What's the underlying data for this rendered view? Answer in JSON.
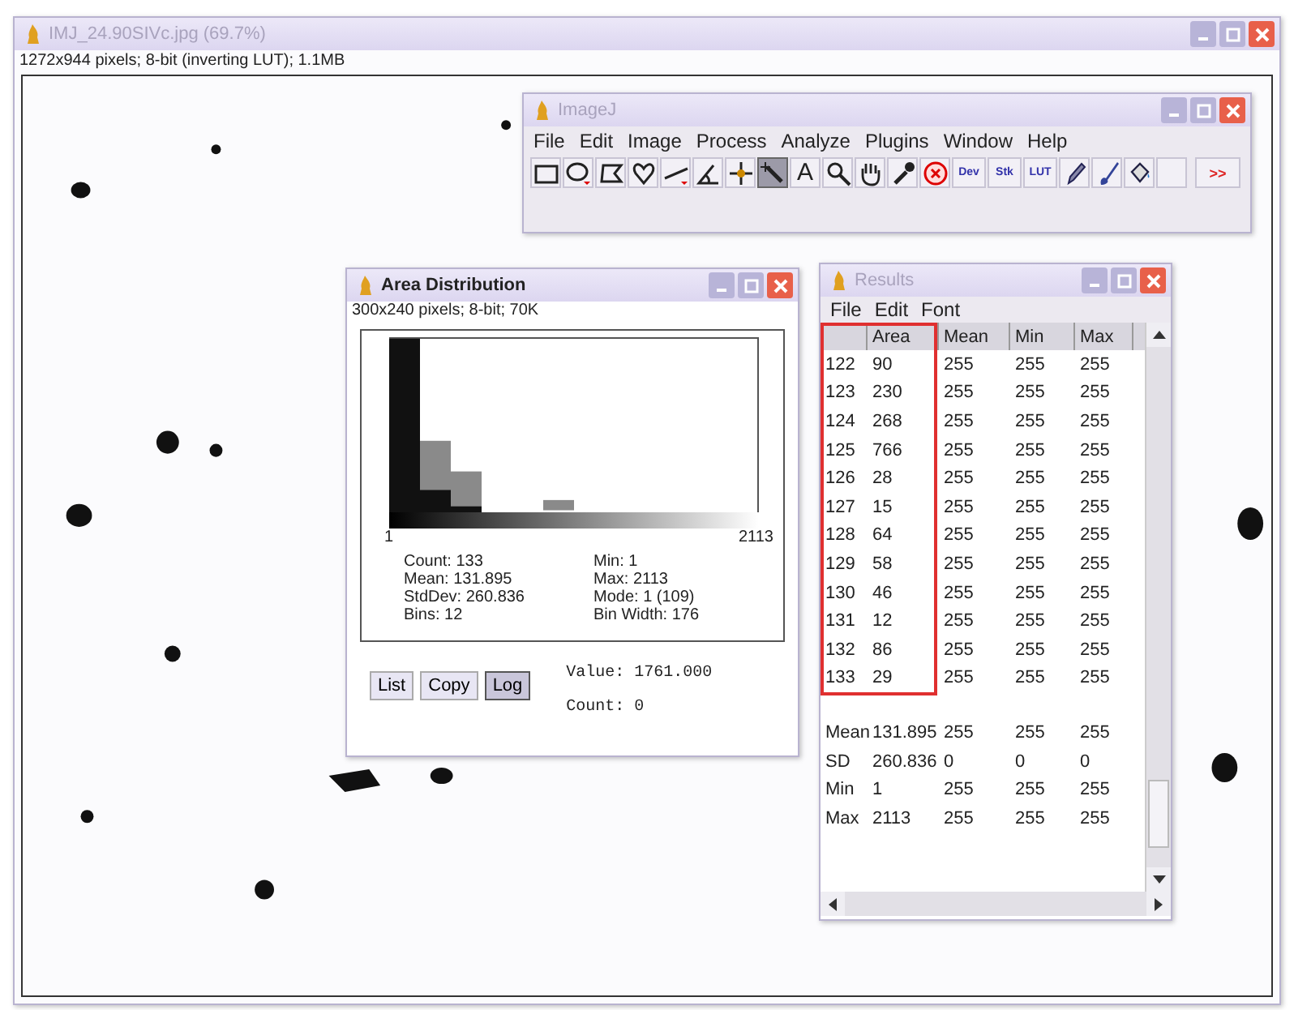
{
  "main_window": {
    "title": "IMJ_24.90SIVc.jpg (69.7%)",
    "active": false,
    "info": "1272x944 pixels; 8-bit (inverting LUT); 1.1MB"
  },
  "imagej_window": {
    "title": "ImageJ",
    "active": false,
    "menu": [
      "File",
      "Edit",
      "Image",
      "Process",
      "Analyze",
      "Plugins",
      "Window",
      "Help"
    ],
    "tools": [
      {
        "kind": "rectangle",
        "selected": false
      },
      {
        "kind": "oval",
        "selected": false
      },
      {
        "kind": "polygon",
        "selected": false
      },
      {
        "kind": "freehand",
        "selected": false
      },
      {
        "kind": "line",
        "selected": false
      },
      {
        "kind": "angle",
        "selected": false
      },
      {
        "kind": "point",
        "selected": false
      },
      {
        "kind": "wand",
        "selected": true
      },
      {
        "kind": "text",
        "label": "A",
        "selected": false
      },
      {
        "kind": "magnifier",
        "selected": false
      },
      {
        "kind": "hand",
        "selected": false
      },
      {
        "kind": "dropper",
        "selected": false
      },
      {
        "kind": "stop",
        "selected": false
      },
      {
        "kind": "menu-tool",
        "label": "Dev",
        "selected": false
      },
      {
        "kind": "menu-tool",
        "label": "Stk",
        "selected": false
      },
      {
        "kind": "menu-tool",
        "label": "LUT",
        "selected": false
      },
      {
        "kind": "pencil",
        "selected": false
      },
      {
        "kind": "brush",
        "selected": false
      },
      {
        "kind": "fill",
        "selected": false
      },
      {
        "kind": "blank",
        "selected": false
      },
      {
        "kind": "more",
        "label": ">>",
        "selected": false
      }
    ]
  },
  "histogram_window": {
    "title": "Area Distribution",
    "active": true,
    "info": "300x240 pixels; 8-bit; 70K",
    "x_min": "1",
    "x_max": "2113",
    "stats_left": [
      "Count: 133",
      "Mean: 131.895",
      "StdDev: 260.836",
      "Bins: 12"
    ],
    "stats_right": [
      "Min: 1",
      "Max: 2113",
      "Mode: 1 (109)",
      "Bin Width: 176"
    ],
    "buttons": [
      {
        "label": "List",
        "selected": false
      },
      {
        "label": "Copy",
        "selected": false
      },
      {
        "label": "Log",
        "selected": true
      }
    ],
    "value": "Value: 1761.000",
    "count": "Count: 0"
  },
  "results_window": {
    "title": "Results",
    "active": false,
    "menu": [
      "File",
      "Edit",
      "Font"
    ],
    "columns": [
      "",
      "Area",
      "Mean",
      "Min",
      "Max"
    ],
    "rows": [
      [
        "122",
        "90",
        "255",
        "255",
        "255"
      ],
      [
        "123",
        "230",
        "255",
        "255",
        "255"
      ],
      [
        "124",
        "268",
        "255",
        "255",
        "255"
      ],
      [
        "125",
        "766",
        "255",
        "255",
        "255"
      ],
      [
        "126",
        "28",
        "255",
        "255",
        "255"
      ],
      [
        "127",
        "15",
        "255",
        "255",
        "255"
      ],
      [
        "128",
        "64",
        "255",
        "255",
        "255"
      ],
      [
        "129",
        "58",
        "255",
        "255",
        "255"
      ],
      [
        "130",
        "46",
        "255",
        "255",
        "255"
      ],
      [
        "131",
        "12",
        "255",
        "255",
        "255"
      ],
      [
        "132",
        "86",
        "255",
        "255",
        "255"
      ],
      [
        "133",
        "29",
        "255",
        "255",
        "255"
      ]
    ],
    "summary": [
      [
        "Mean",
        "131.895",
        "255",
        "255",
        "255"
      ],
      [
        "SD",
        "260.836",
        "0",
        "0",
        "0"
      ],
      [
        "Min",
        "1",
        "255",
        "255",
        "255"
      ],
      [
        "Max",
        "2113",
        "255",
        "255",
        "255"
      ]
    ]
  }
}
